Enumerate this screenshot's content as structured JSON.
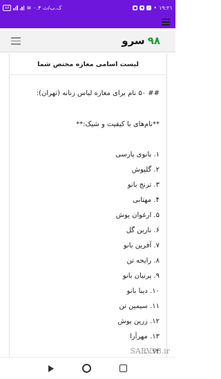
{
  "status_bar": {
    "time": "۱۹:۲۱",
    "network_speed": "۰.۴ ک.ب/ث",
    "battery": "۸۶"
  },
  "site": {
    "logo_number": "۹۸",
    "logo_text": "سرو"
  },
  "article": {
    "title": "لیست اسامی مغازه مختص شما",
    "heading": "## ۵۰ نام برای مغازه لباس زنانه (تهران):",
    "subheading": "**نام‌های با کیفیت و شیک:**",
    "items": [
      "۱. بانوی پارسی",
      "۲. گلپوش",
      "۳. ترنج بانو",
      "۴. مهتابی",
      "۵. ارغوان پوش",
      "۶. نارین گل",
      "۷. آفرین بانو",
      "۸. رایحه تن",
      "۹. پرنیان بانو",
      "۱۰. دیبا بانو",
      "۱۱. سیمین تن",
      "۱۲. زرین پوش",
      "۱۳. مهرآرا",
      "۱۴. ..."
    ]
  },
  "watermark": "SARV98.ir"
}
